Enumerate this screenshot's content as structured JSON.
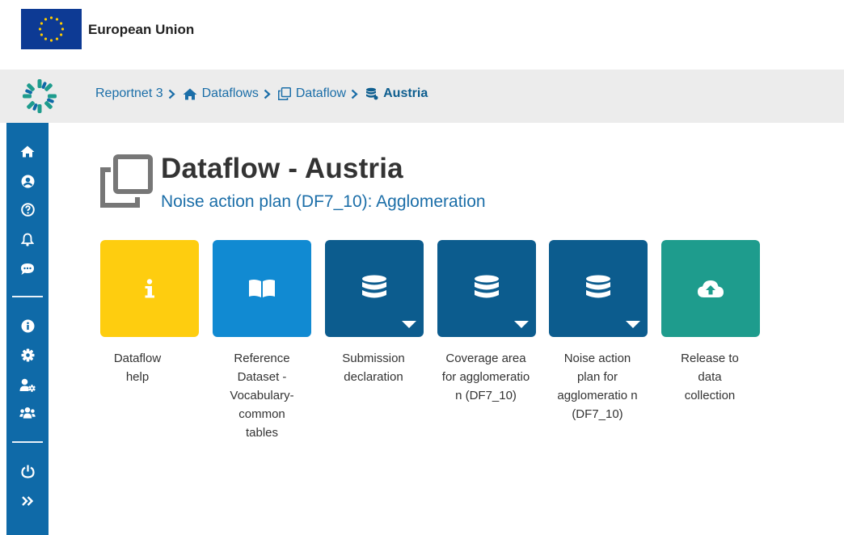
{
  "eu_bar": {
    "label": "European Union"
  },
  "breadcrumb": [
    {
      "label": "Reportnet 3",
      "icon": "none"
    },
    {
      "label": "Dataflows",
      "icon": "home-icon"
    },
    {
      "label": "Dataflow",
      "icon": "clone-icon"
    },
    {
      "label": "Austria",
      "icon": "database-icon"
    }
  ],
  "sidebar": {
    "top_icons": [
      "home-icon",
      "user-icon",
      "help-icon",
      "bell-icon",
      "comment-icon"
    ],
    "middle_icons": [
      "info-icon",
      "settings-icon",
      "user-settings-icon",
      "users-icon"
    ],
    "bottom_icons": [
      "power-icon",
      "expand-icon"
    ]
  },
  "page": {
    "title": "Dataflow - Austria",
    "subtitle": "Noise action plan (DF7_10): Agglomeration"
  },
  "tiles": [
    {
      "label": "Dataflow help",
      "icon": "info-icon",
      "color": "#fecd0f",
      "has_dropdown": false
    },
    {
      "label": "Reference Dataset - Vocabulary-common tables",
      "icon": "book-icon",
      "color": "#118ad2",
      "has_dropdown": false
    },
    {
      "label": "Submission declaration",
      "icon": "database-icon",
      "color": "#0c5c8e",
      "has_dropdown": true
    },
    {
      "label": "Coverage area for agglomeratio n (DF7_10)",
      "icon": "database-icon",
      "color": "#0c5c8e",
      "has_dropdown": true
    },
    {
      "label": "Noise action plan for agglomeratio n (DF7_10)",
      "icon": "database-icon",
      "color": "#0c5c8e",
      "has_dropdown": true
    },
    {
      "label": "Release to data collection",
      "icon": "cloud-upload-icon",
      "color": "#1e9c8d",
      "has_dropdown": false
    }
  ]
}
